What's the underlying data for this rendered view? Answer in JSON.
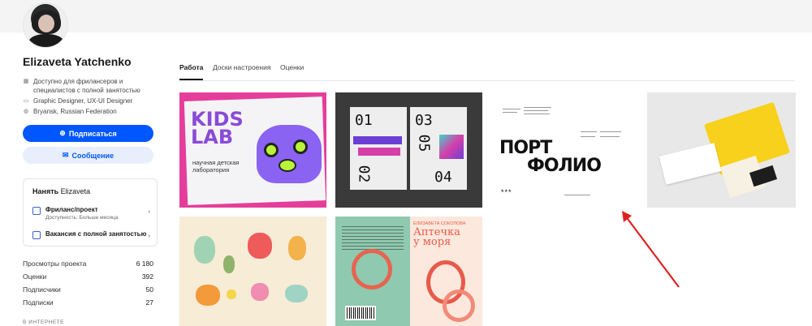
{
  "profile": {
    "name": "Elizaveta Yatchenko",
    "availability": "Доступно для фрилансеров и специалистов с полной занятостью",
    "availability_line1": "Доступно для фрилансеров и",
    "availability_line2": "специалистов с полной занятостью",
    "role": "Graphic Designer, UX-UI Designer",
    "location": "Bryansk, Russian Federation"
  },
  "actions": {
    "follow_label": "Подписаться",
    "message_label": "Сообщение"
  },
  "hire": {
    "title_prefix": "Нанять",
    "title_name": "Elizaveta",
    "items": [
      {
        "label": "Фриланс/проект",
        "sub": "Доступность: Больше месяца"
      },
      {
        "label": "Вакансия с полной занятостью",
        "sub": ""
      }
    ]
  },
  "stats": [
    {
      "label": "Просмотры проекта",
      "value": "6 180"
    },
    {
      "label": "Оценки",
      "value": "392"
    },
    {
      "label": "Подписчики",
      "value": "50"
    },
    {
      "label": "Подписки",
      "value": "27"
    }
  ],
  "section_footer": "В ИНТЕРНЕТЕ",
  "tabs": [
    {
      "label": "Работа",
      "active": true
    },
    {
      "label": "Доски настроения",
      "active": false
    },
    {
      "label": "Оценки",
      "active": false
    }
  ],
  "projects": {
    "kids_lab": {
      "title_line1": "KIDS",
      "title_line2": "LAB",
      "subtitle_line1": "научная детская",
      "subtitle_line2": "лаборатория"
    },
    "magazine": {
      "numbers": [
        "01",
        "03",
        "02",
        "05",
        "04"
      ]
    },
    "portfolio": {
      "title_line1": "ПОРТ",
      "title_line2": "ФОЛИО",
      "stars": "***"
    },
    "book": {
      "author": "ЕЛИЗАВЕТА СОКОЛОВА",
      "title_line1": "Аптечка",
      "title_line2": "у моря"
    }
  },
  "colors": {
    "accent": "#0057ff",
    "annotation_arrow": "#e02020"
  }
}
